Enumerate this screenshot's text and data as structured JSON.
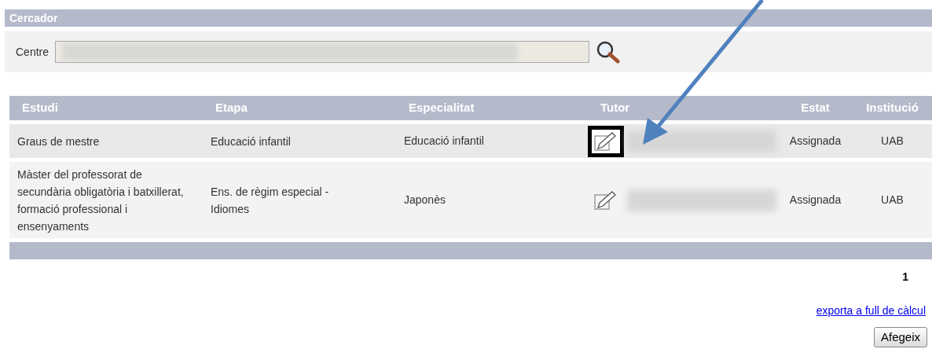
{
  "search_panel": {
    "title": "Cercador",
    "field_label": "Centre"
  },
  "table": {
    "columns": [
      "Estudi",
      "Etapa",
      "Especialitat",
      "Tutor",
      "Estat",
      "Institució"
    ],
    "rows": [
      {
        "estudi": "Graus de mestre",
        "etapa": "Educació infantil",
        "especialitat": "Educació infantil",
        "tutor_highlighted": true,
        "estat": "Assignada",
        "institucio": "UAB"
      },
      {
        "estudi": "Màster del professorat de secundària obligatòria i batxillerat, formació professional i ensenyaments",
        "etapa": "Ens. de règim especial - Idiomes",
        "especialitat": "Japonès",
        "tutor_highlighted": false,
        "estat": "Assignada",
        "institucio": "UAB"
      }
    ]
  },
  "pagination": {
    "pages": [
      {
        "label": "1",
        "selected": true
      }
    ]
  },
  "export_link": "exporta a full de càlcul",
  "add_button": "Afegeix"
}
